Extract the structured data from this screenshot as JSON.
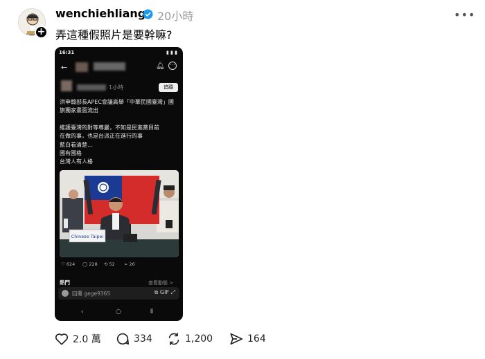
{
  "post": {
    "author": "wenchiehliang",
    "time": "20小時",
    "text": "弄這種假照片是要幹嘛?",
    "more_icon": "more-horizontal-icon",
    "verified_icon": "verified-badge-icon"
  },
  "embedded": {
    "status_time": "16:31",
    "status_right": "▮ ▮ ▮",
    "post_time": "1小時",
    "follow_label": "追蹤",
    "headline": "洪申翰部長APEC會議高舉「中華民國臺灣」國旗獨家畫面流出",
    "body_lines": [
      "維護臺灣的對等尊嚴，不知是民進黨目前",
      "在做的事，也是台派正在進行的事",
      "藍白看清楚…",
      "國有國格",
      "台灣人有人格"
    ],
    "photo_placard": "Chinese Taipei",
    "likes": "624",
    "comments": "228",
    "reposts": "52",
    "shares": "26",
    "hot_label": "熱門",
    "activity_label": "查看動態 >",
    "reply_placeholder": "回覆 gege9365",
    "reply_icons": "⧉ GIF ⤢"
  },
  "actions": {
    "likes": "2.0 萬",
    "comments": "334",
    "reposts": "1,200",
    "shares": "164"
  }
}
